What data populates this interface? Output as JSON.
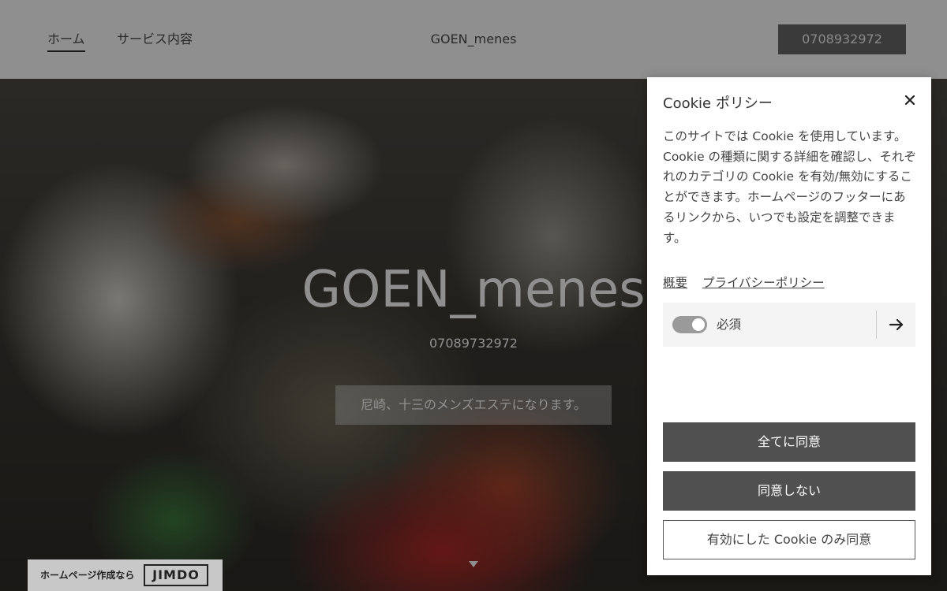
{
  "header": {
    "nav": [
      {
        "label": "ホーム",
        "active": true
      },
      {
        "label": "サービス内容",
        "active": false
      }
    ],
    "logo": "GOEN_menes",
    "phone_button": "0708932972"
  },
  "hero": {
    "title": "GOEN_menes",
    "phone": "07089732972",
    "tagline": "尼崎、十三のメンズエステになります。"
  },
  "jimdo": {
    "text": "ホームページ作成なら",
    "logo": "JIMDO"
  },
  "cookie": {
    "title": "Cookie ポリシー",
    "description": "このサイトでは Cookie を使用しています。Cookie の種類に関する詳細を確認し、それぞれのカテゴリの Cookie を有効/無効にすることができます。ホームページのフッターにあるリンクから、いつでも設定を調整できます。",
    "links": [
      "概要",
      "プライバシーポリシー"
    ],
    "category": {
      "label": "必須",
      "enabled": true
    },
    "buttons": {
      "accept_all": "全てに同意",
      "reject": "同意しない",
      "accept_selected": "有効にした Cookie のみ同意"
    }
  },
  "icons": {
    "close": "close-icon",
    "arrow": "arrow-right-icon",
    "scroll": "chevron-down-icon"
  },
  "colors": {
    "button_dark": "#505050",
    "overlay": "rgba(0,0,0,0.44)"
  }
}
